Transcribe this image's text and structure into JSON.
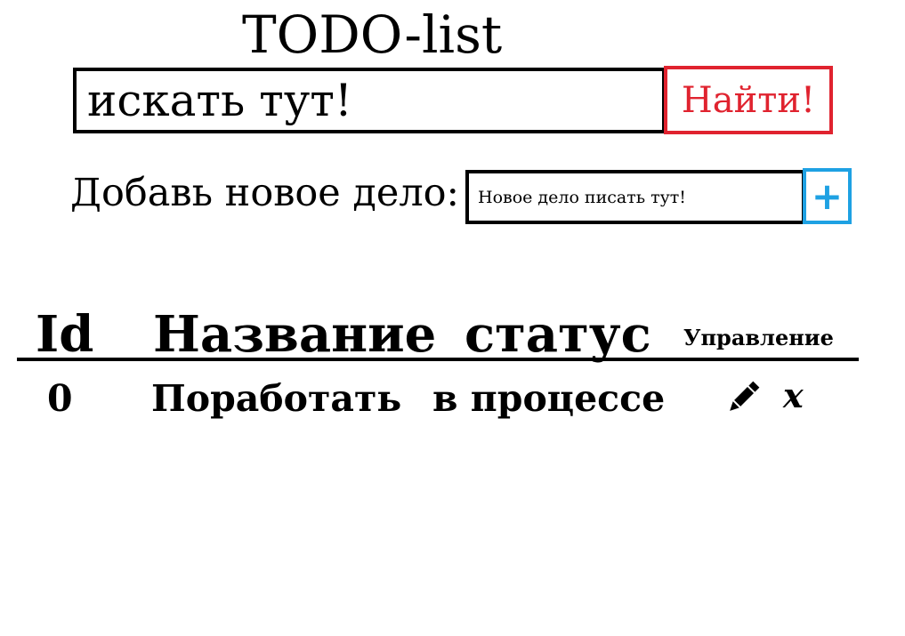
{
  "app": {
    "title": "TODO-list"
  },
  "search": {
    "placeholder": "искать тут!",
    "button_label": "Найти!"
  },
  "add": {
    "label": "Добавь новое дело:",
    "placeholder": "Новое дело писать тут!",
    "button_label": "+"
  },
  "table": {
    "columns": {
      "id": "Id",
      "name": "Название",
      "status": "статус",
      "actions": "Управление"
    },
    "rows": [
      {
        "id": "0",
        "name": "Поработать",
        "status": "в процессе",
        "edit_icon": "pencil-icon",
        "delete_label": "x"
      }
    ]
  },
  "colors": {
    "search_button": "#e0232f",
    "add_button": "#1ea1e3",
    "text": "#000000"
  }
}
